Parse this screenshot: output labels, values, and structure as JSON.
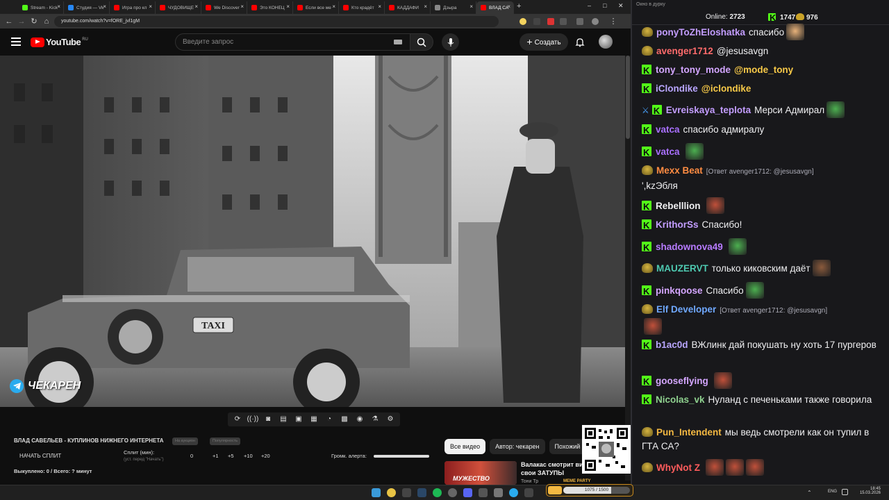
{
  "browser": {
    "tabs": [
      {
        "label": "Stream - Kick",
        "color": "#53fc18"
      },
      {
        "label": "Студия — Vk",
        "color": "#2787f5"
      },
      {
        "label": "Игра про кл",
        "color": "#ff0000"
      },
      {
        "label": "ЧУДОВИЩЕ",
        "color": "#ff0000"
      },
      {
        "label": "We Discover",
        "color": "#ff0000"
      },
      {
        "label": "Это КОНЕЦ",
        "color": "#ff0000"
      },
      {
        "label": "Если все ме",
        "color": "#ff0000"
      },
      {
        "label": "Кто крадёт",
        "color": "#ff0000"
      },
      {
        "label": "КАДДАФИ",
        "color": "#ff0000"
      },
      {
        "label": "Дзыра",
        "color": "#888888"
      },
      {
        "label": "ВЛАД СА",
        "color": "#ff0000"
      }
    ],
    "new_tab": "+",
    "url": "youtube.com/watch?v=fORE_jvl1gM",
    "window_controls": [
      "–",
      "□",
      "✕"
    ]
  },
  "youtube": {
    "logo": "YouTube",
    "logo_region": "RU",
    "search_placeholder": "Введите запрос",
    "create_label": "Создать"
  },
  "video": {
    "watermark": "ЧЕКАРЕН",
    "taxi_sign": "TAXI"
  },
  "tool": {
    "title": "ВЛАД САВЕЛЬЕВ - КУПЛИНОВ НИЖНЕГО ИНТЕРНЕТА",
    "pill1": "На аукцион",
    "pill2": "Популярность",
    "split_button": "НАЧАТЬ СПЛИТ",
    "split_label": "Сплит (мин):",
    "split_hint": "(уст. перед \"Начать\")",
    "split_value": "0",
    "increments": [
      "+1",
      "+5",
      "+10",
      "+20"
    ],
    "volume_label": "Громк. алерта:",
    "volume_level": 1.0,
    "bought": "Выкуплено: 0 / Всего: ? минут"
  },
  "chips": [
    "Все видео",
    "Автор: чекарен",
    "Похожий ко"
  ],
  "recommendation": {
    "title_line1": "Валакас смотрит вид",
    "title_line2": "свои ЗАТУПЫ",
    "channel": "Тони Тр",
    "thumb_text": "МУЖЕСТВО"
  },
  "meme_party": {
    "label": "MEME PARTY",
    "progress_text": "1075 / 1500",
    "progress": 0.72
  },
  "chat": {
    "window_title": "Окно в дурку",
    "online_label": "Online:",
    "online_count": "2723",
    "kick_count": "1747",
    "other_count": "976",
    "messages": [
      {
        "user": "ponyToZhEloshatka",
        "color": "#c39dff",
        "text": "спасибо",
        "badge": "other",
        "emote": "#e8b27a"
      },
      {
        "user": "avenger1712",
        "color": "#ff6b6b",
        "text": "@jesusavgn",
        "badge": "other"
      },
      {
        "user": "tony_tony_mode",
        "color": "#d3a6ff",
        "text": "@mode_tony",
        "mention": true,
        "badge": "kick"
      },
      {
        "user": "iClondike",
        "color": "#b9a6ff",
        "text": "@iclondike",
        "mention": true,
        "badge": "kick"
      },
      {
        "user": "Evreiskaya_teplota",
        "color": "#c39dff",
        "text": "Мерси Адмирал",
        "badge": "kick",
        "extra_badge": true,
        "emote": "#4caf50"
      },
      {
        "user": "vatca",
        "color": "#a970ff",
        "text": "спасибо адмиралу",
        "badge": "kick"
      },
      {
        "user": "vatca",
        "color": "#a970ff",
        "text": "",
        "badge": "kick",
        "emote": "#4caf50"
      },
      {
        "user": "Mexx Beat",
        "color": "#ff8c42",
        "reply": "[Ответ avenger1712: @jesusavgn]",
        "text": "',kzЭбля",
        "badge": "other"
      },
      {
        "user": "Rebelllion",
        "color": "#efeff1",
        "text": "",
        "badge": "kick",
        "emote": "#c0503a"
      },
      {
        "user": "KrithorSs",
        "color": "#c39dff",
        "text": "Спасибо!",
        "badge": "kick"
      },
      {
        "user": "shadownova49",
        "color": "#b77bff",
        "text": "",
        "badge": "kick",
        "emote": "#4caf50"
      },
      {
        "user": "MAUZERVT",
        "color": "#4ec9b0",
        "text": "только киковским даёт",
        "badge": "other",
        "emote": "#8a5a3c"
      },
      {
        "user": "pinkqoose",
        "color": "#d4a6ff",
        "text": "Спасибо",
        "badge": "kick",
        "emote": "#4caf50"
      },
      {
        "user": "Elf Developer",
        "color": "#6fa8ff",
        "reply": "[Ответ avenger1712: @jesusavgn]",
        "text": "",
        "badge": "other",
        "emote": "#c0503a"
      },
      {
        "user": "b1ac0d",
        "color": "#b9a6ff",
        "text": "ВЖлинк дай покушать ну хоть 17 пургеров",
        "badge": "kick"
      },
      {
        "user": "gooseflying",
        "color": "#d4a6ff",
        "text": "",
        "badge": "kick",
        "emote": "#c0503a"
      },
      {
        "user": "Nicolas_vk",
        "color": "#8fd18f",
        "text": "Нуланд с печеньками также говорила",
        "badge": "kick"
      },
      {
        "user": "Pun_Intendent",
        "color": "#f5b942",
        "text": "мы ведь смотрели как он тупил в ГТА СА?",
        "badge": "other"
      },
      {
        "user": "WhyNot Z",
        "color": "#ff5c5c",
        "text": "",
        "badge": "other",
        "emote": "#c0503a",
        "emote_count": 3
      }
    ]
  },
  "taskbar": {
    "lang": "ENG",
    "time": "18:45",
    "date": "15.03.2026"
  },
  "colors": {
    "kick_green": "#53fc18",
    "youtube_red": "#ff0000",
    "mention_yellow": "#f7c948"
  }
}
